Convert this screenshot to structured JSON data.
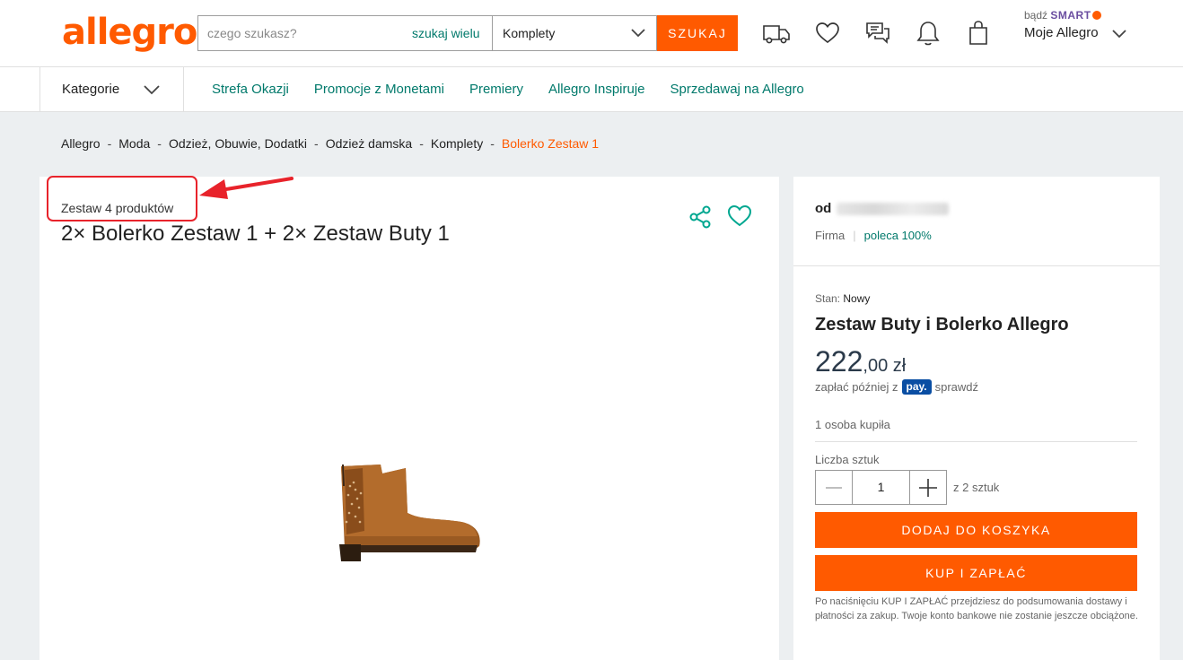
{
  "header": {
    "logo": "allegro",
    "search": {
      "placeholder": "czego szukasz?",
      "multi_search_link": "szukaj wielu",
      "category_select": "Komplety",
      "submit_label": "SZUKAJ"
    },
    "icons": [
      "delivery-truck-icon",
      "heart-icon",
      "chat-icon",
      "bell-icon",
      "shopping-bag-icon"
    ],
    "smart_prefix": "bądź",
    "smart_brand": "SMART",
    "account_label": "Moje Allegro"
  },
  "nav": {
    "categories_label": "Kategorie",
    "links": [
      "Strefa Okazji",
      "Promocje z Monetami",
      "Premiery",
      "Allegro Inspiruje",
      "Sprzedawaj na Allegro"
    ]
  },
  "breadcrumb": {
    "items": [
      "Allegro",
      "Moda",
      "Odzież, Obuwie, Dodatki",
      "Odzież damska",
      "Komplety"
    ],
    "current": "Bolerko Zestaw 1",
    "separator": "-"
  },
  "product": {
    "set_label": "Zestaw 4 produktów",
    "title": "2× Bolerko Zestaw 1 + 2× Zestaw Buty 1",
    "image": "brown-suede-ankle-boot"
  },
  "offer": {
    "seller_prefix": "od",
    "seller_type": "Firma",
    "recommend": "poleca 100%",
    "condition_label": "Stan:",
    "condition_value": "Nowy",
    "title": "Zestaw Buty i Bolerko Allegro",
    "price_int": "222",
    "price_dec": ",00 zł",
    "pay_prefix": "zapłać później z",
    "pay_badge": "pay.",
    "pay_link": "sprawdź",
    "bought": "1 osoba kupiła",
    "quantity_label": "Liczba sztuk",
    "quantity": "1",
    "quantity_of": "z 2 sztuk",
    "add_to_cart": "DODAJ DO KOSZYKA",
    "buy_now": "KUP I ZAPŁAĆ",
    "disclaimer": "Po naciśnięciu KUP I ZAPŁAĆ przejdziesz do podsumowania dostawy i płatności za zakup. Twoje konto bankowe nie zostanie jeszcze obciążone."
  },
  "colors": {
    "brand": "#ff5a00",
    "link": "#00796b",
    "annotation": "#e8232b",
    "background": "#eceff1"
  }
}
